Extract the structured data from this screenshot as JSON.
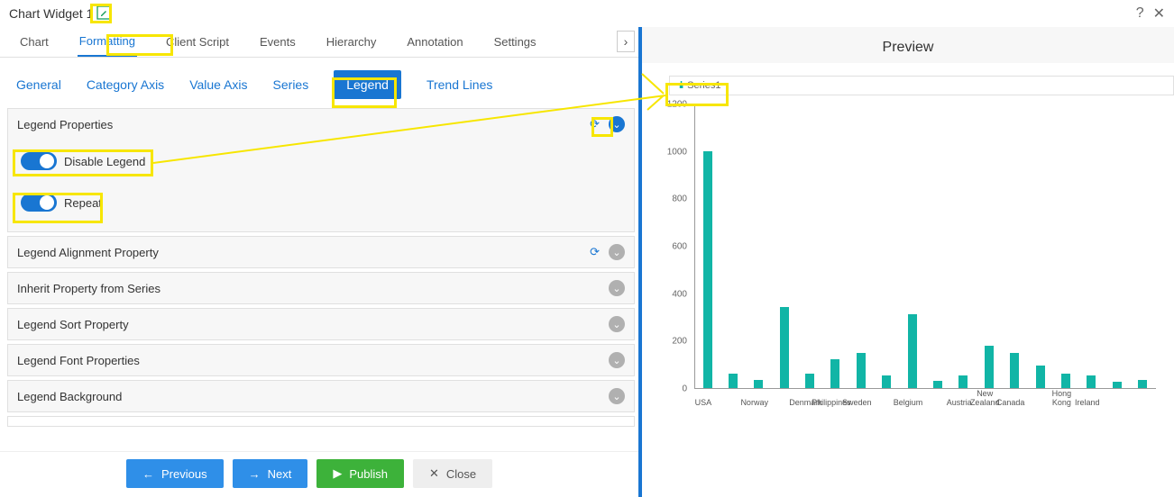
{
  "title": "Chart Widget 1",
  "primary_tabs": [
    "Chart",
    "Formatting",
    "Client Script",
    "Events",
    "Hierarchy",
    "Annotation",
    "Settings"
  ],
  "primary_active": "Formatting",
  "sub_tabs": [
    "General",
    "Category Axis",
    "Value Axis",
    "Series",
    "Legend",
    "Trend Lines"
  ],
  "sub_active": "Legend",
  "panels": {
    "legend_properties": {
      "title": "Legend Properties",
      "open": true,
      "refresh": true,
      "toggles": {
        "disable_legend": {
          "label": "Disable Legend",
          "on": true
        },
        "repeat": {
          "label": "Repeat",
          "on": true
        }
      }
    },
    "alignment": {
      "title": "Legend Alignment Property",
      "open": false,
      "refresh": true
    },
    "inherit": {
      "title": "Inherit Property from Series",
      "open": false,
      "refresh": false
    },
    "sort": {
      "title": "Legend Sort Property",
      "open": false,
      "refresh": false
    },
    "font": {
      "title": "Legend Font Properties",
      "open": false,
      "refresh": false
    },
    "background": {
      "title": "Legend Background",
      "open": false,
      "refresh": false
    }
  },
  "footer": {
    "previous": "Previous",
    "next": "Next",
    "publish": "Publish",
    "close": "Close"
  },
  "preview": {
    "title": "Preview",
    "legend_label": "Series1"
  },
  "chart_data": {
    "type": "bar",
    "title": "",
    "xlabel": "",
    "ylabel": "",
    "ylim": [
      0,
      1200
    ],
    "yticks": [
      0,
      200,
      400,
      600,
      800,
      1000,
      1200
    ],
    "categories": [
      "USA",
      "",
      "Norway",
      "",
      "Denmark",
      "Philippines",
      "Sweden",
      "",
      "Belgium",
      "",
      "Austria",
      "New Zealand",
      "Canada",
      "",
      "Hong Kong",
      "Ireland",
      ""
    ],
    "series": [
      {
        "name": "Series1",
        "values": [
          1000,
          60,
          35,
          340,
          60,
          120,
          150,
          55,
          310,
          30,
          55,
          180,
          150,
          95,
          60,
          55,
          25,
          35
        ],
        "x_offsets": [
          0,
          1,
          2,
          3,
          4,
          5,
          6,
          7,
          8,
          9,
          10,
          11,
          12,
          13,
          14,
          15,
          16,
          17
        ]
      }
    ],
    "xtick_labels": [
      {
        "pos": 0,
        "label": "USA"
      },
      {
        "pos": 2,
        "label": "Norway"
      },
      {
        "pos": 4,
        "label": "Denmark"
      },
      {
        "pos": 5,
        "label": "Philippines"
      },
      {
        "pos": 6,
        "label": "Sweden"
      },
      {
        "pos": 8,
        "label": "Belgium"
      },
      {
        "pos": 10,
        "label": "Austria"
      },
      {
        "pos": 11,
        "label": "New Zealand"
      },
      {
        "pos": 12,
        "label": "Canada"
      },
      {
        "pos": 14,
        "label": "Hong Kong"
      },
      {
        "pos": 15,
        "label": "Ireland"
      }
    ]
  }
}
